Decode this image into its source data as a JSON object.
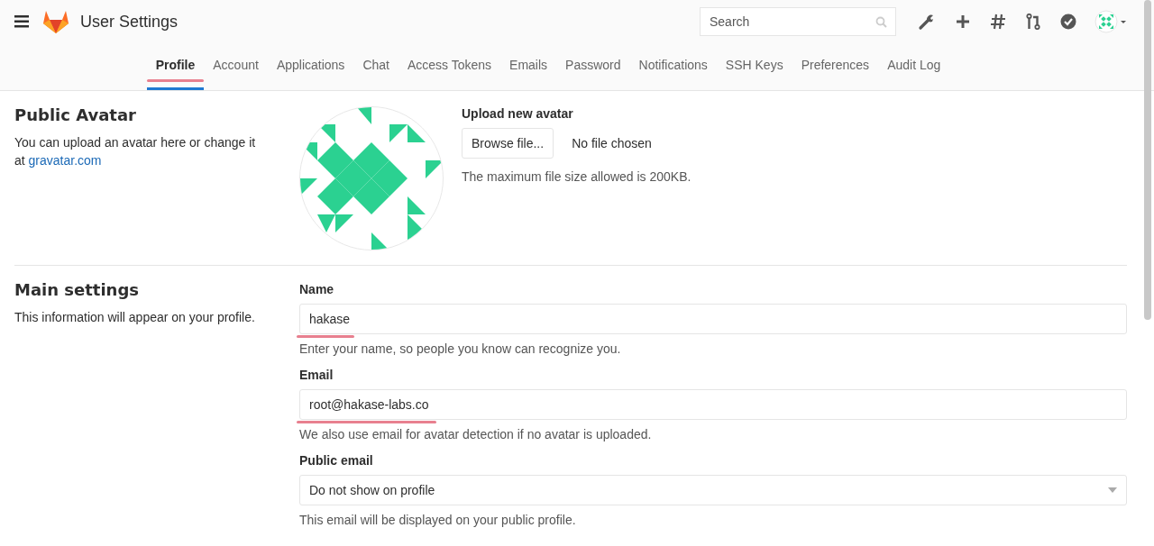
{
  "header": {
    "title": "User Settings",
    "search": {
      "placeholder": "Search"
    }
  },
  "tabs": [
    {
      "label": "Profile",
      "selected": true,
      "annotated": true
    },
    {
      "label": "Account",
      "selected": false,
      "annotated": false
    },
    {
      "label": "Applications",
      "selected": false,
      "annotated": false
    },
    {
      "label": "Chat",
      "selected": false,
      "annotated": false
    },
    {
      "label": "Access Tokens",
      "selected": false,
      "annotated": false
    },
    {
      "label": "Emails",
      "selected": false,
      "annotated": false
    },
    {
      "label": "Password",
      "selected": false,
      "annotated": false
    },
    {
      "label": "Notifications",
      "selected": false,
      "annotated": false
    },
    {
      "label": "SSH Keys",
      "selected": false,
      "annotated": false
    },
    {
      "label": "Preferences",
      "selected": false,
      "annotated": false
    },
    {
      "label": "Audit Log",
      "selected": false,
      "annotated": false
    }
  ],
  "avatar_section": {
    "title": "Public Avatar",
    "description": "You can upload an avatar here or change it at",
    "link": "gravatar.com",
    "upload_label": "Upload new avatar",
    "browse_button": "Browse file...",
    "file_status": "No file chosen",
    "help": "The maximum file size allowed is 200KB."
  },
  "main_section": {
    "title": "Main settings",
    "description": "This information will appear on your profile.",
    "fields": [
      {
        "kind": "text",
        "label": "Name",
        "value": "hakase",
        "help": "Enter your name, so people you know can recognize you.",
        "annotated": true
      },
      {
        "kind": "text",
        "label": "Email",
        "value": "root@hakase-labs.co",
        "help": "We also use email for avatar detection if no avatar is uploaded.",
        "annotated": true
      },
      {
        "kind": "select",
        "label": "Public email",
        "value": "Do not show on profile",
        "help": "This email will be displayed on your public profile.",
        "annotated": false
      }
    ]
  }
}
